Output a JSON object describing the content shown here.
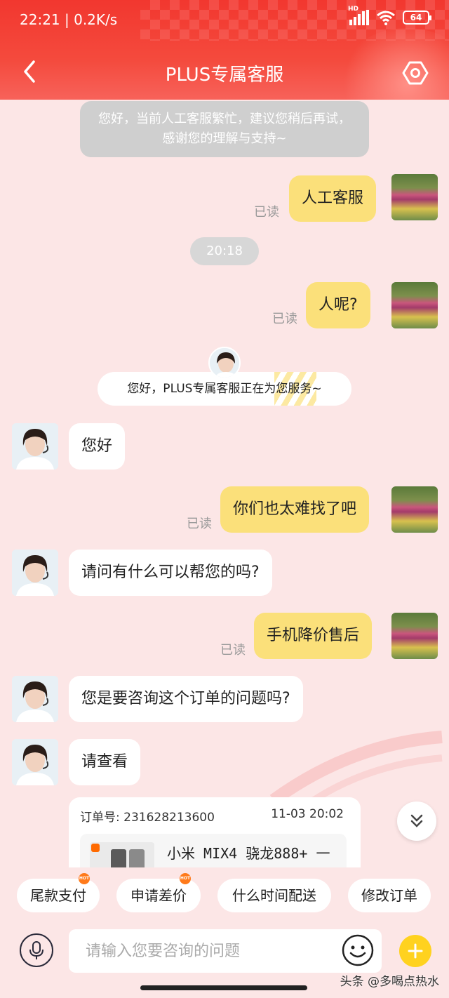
{
  "status_bar": {
    "time": "22:21 | 0.2K/s",
    "network": "HD",
    "battery": "64"
  },
  "header": {
    "title": "PLUS专属客服"
  },
  "chat": {
    "system_notice": "您好，当前人工客服繁忙，建议您稍后再试，感谢您的理解与支持~",
    "messages": [
      {
        "from": "me",
        "text": "人工客服",
        "status": "已读"
      },
      {
        "from": "time",
        "text": "20:18"
      },
      {
        "from": "me",
        "text": "人呢?",
        "status": "已读"
      },
      {
        "from": "agent-banner",
        "text": "您好，PLUS专属客服正在为您服务~"
      },
      {
        "from": "agent",
        "text": "您好"
      },
      {
        "from": "me",
        "text": "你们也太难找了吧",
        "status": "已读"
      },
      {
        "from": "agent",
        "text": "请问有什么可以帮您的吗?"
      },
      {
        "from": "me",
        "text": "手机降价售后",
        "status": "已读"
      },
      {
        "from": "agent",
        "text": "您是要咨询这个订单的问题吗?"
      },
      {
        "from": "agent",
        "text": "请查看"
      }
    ],
    "order": {
      "number": "订单号: 231628213600",
      "time": "11-03 20:02",
      "product": "小米 MIX4 骁龙888+ 一"
    }
  },
  "quick_replies": [
    {
      "label": "尾款支付",
      "hot": true
    },
    {
      "label": "申请差价",
      "hot": true
    },
    {
      "label": "什么时间配送",
      "hot": false
    },
    {
      "label": "修改订单",
      "hot": false
    }
  ],
  "input": {
    "placeholder": "请输入您要咨询的问题"
  },
  "watermark": "头条 @多喝点热水",
  "icons": {
    "back": "chevron-left-icon",
    "settings": "hexagon-settings-icon",
    "mic": "microphone-icon",
    "emoji": "smiley-icon",
    "plus": "plus-icon",
    "scroll": "double-chevron-down-icon"
  },
  "colors": {
    "header": "#f2372f",
    "my_bubble": "#fbe07a",
    "agent_bubble": "#ffffff",
    "plus_button": "#ffd21f",
    "background": "#fce6e6"
  }
}
